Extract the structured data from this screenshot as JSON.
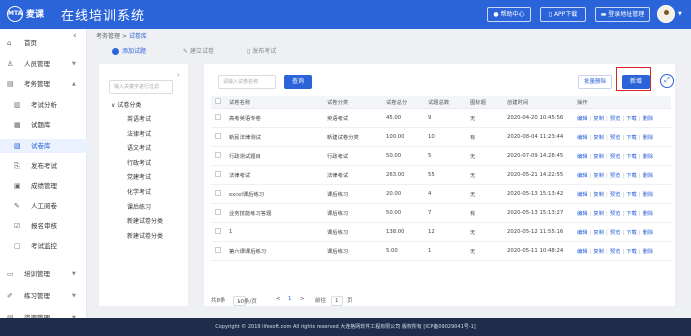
{
  "header": {
    "logo_text": "MTA",
    "brand": "麦课",
    "app_title": "在线培训系统",
    "buttons": [
      "帮助中心",
      "APP下载",
      "登录地址管理"
    ]
  },
  "sidebar": {
    "items": [
      {
        "icon": "home-icon",
        "glyph": "⌂",
        "label": "首页",
        "arrow": ""
      },
      {
        "icon": "user-icon",
        "glyph": "♙",
        "label": "人员管理",
        "arrow": "▼"
      },
      {
        "icon": "exam-icon",
        "glyph": "▤",
        "label": "考务管理",
        "arrow": "▲"
      },
      {
        "icon": "analysis-icon",
        "glyph": "▥",
        "label": "考试分析",
        "sub": true
      },
      {
        "icon": "question-bank-icon",
        "glyph": "▦",
        "label": "试题库",
        "sub": true
      },
      {
        "icon": "paper-bank-icon",
        "glyph": "▧",
        "label": "试卷库",
        "sub": true,
        "active": true
      },
      {
        "icon": "publish-icon",
        "glyph": "⎘",
        "label": "发布考试",
        "sub": true
      },
      {
        "icon": "score-icon",
        "glyph": "▣",
        "label": "成绩管理",
        "sub": true
      },
      {
        "icon": "grading-icon",
        "glyph": "✎",
        "label": "人工阅卷",
        "sub": true
      },
      {
        "icon": "review-icon",
        "glyph": "☑",
        "label": "报名审核",
        "sub": true
      },
      {
        "icon": "monitor-icon",
        "glyph": "▢",
        "label": "考试监控",
        "sub": true
      },
      {
        "icon": "training-icon",
        "glyph": "▭",
        "label": "培训管理",
        "arrow": "▼"
      },
      {
        "icon": "practice-icon",
        "glyph": "✐",
        "label": "练习管理",
        "arrow": "▼"
      },
      {
        "icon": "resource-icon",
        "glyph": "▤",
        "label": "资源管理",
        "arrow": "▼"
      }
    ]
  },
  "breadcrumb": {
    "parent": "考务管理",
    "sep": ">",
    "current": "试卷库"
  },
  "steps": [
    "添加试题",
    "建立试卷",
    "发布考试"
  ],
  "tree": {
    "search_placeholder": "输入关键字进行过滤",
    "root": "试卷分类",
    "children": [
      "英语考试",
      "法律考试",
      "语文考试",
      "行政考试",
      "党建考试",
      "化学考试",
      "课后练习",
      "新建试卷分类",
      "新建试卷分类"
    ]
  },
  "toolbar": {
    "search_placeholder": "请输入试卷名称",
    "search_label": "查询",
    "batch_delete_label": "批量删除",
    "new_label": "新增"
  },
  "table": {
    "headers": [
      "试卷名称",
      "试卷分类",
      "试卷总分",
      "试题总数",
      "图标题",
      "创建时间",
      "操作"
    ],
    "rows": [
      [
        "高考英语专卷",
        "英语考试",
        "45.00",
        "9",
        "无",
        "2020-04-20 10:45:56"
      ],
      [
        "新民法律测试",
        "新建试卷分类",
        "100.00",
        "10",
        "有",
        "2020-08-04 11:23:44"
      ],
      [
        "行政测试题目",
        "行政考试",
        "50.00",
        "5",
        "无",
        "2020-07-09 14:28:45"
      ],
      [
        "法律考试",
        "法律考试",
        "263.00",
        "55",
        "无",
        "2020-05-21 14:22:55"
      ],
      [
        "excel课后练习",
        "课后练习",
        "20.00",
        "4",
        "无",
        "2020-05-13 15:13:42"
      ],
      [
        "业务技能练习答题",
        "课后练习",
        "50.00",
        "7",
        "有",
        "2020-05-13 15:13:27"
      ],
      [
        "1",
        "课后练习",
        "138.00",
        "12",
        "无",
        "2020-05-12 11:55:16"
      ],
      [
        "第六课课后练习",
        "课后练习",
        "5.00",
        "1",
        "无",
        "2020-05-11 10:48:24"
      ]
    ],
    "ops": [
      "编辑",
      "复制",
      "预览",
      "下载",
      "删除"
    ]
  },
  "pager": {
    "total": "共8条",
    "page_size": "10条/页",
    "prev": "<",
    "page": "1",
    "next": ">",
    "goto": "前往",
    "goto_value": "1",
    "suffix": "页"
  },
  "footer": {
    "text": "Copyright © 2019 lifesoft.com All rights reserved 大连格网软件工程有限公司 版权所有 [ICP备09029041号-1]"
  }
}
